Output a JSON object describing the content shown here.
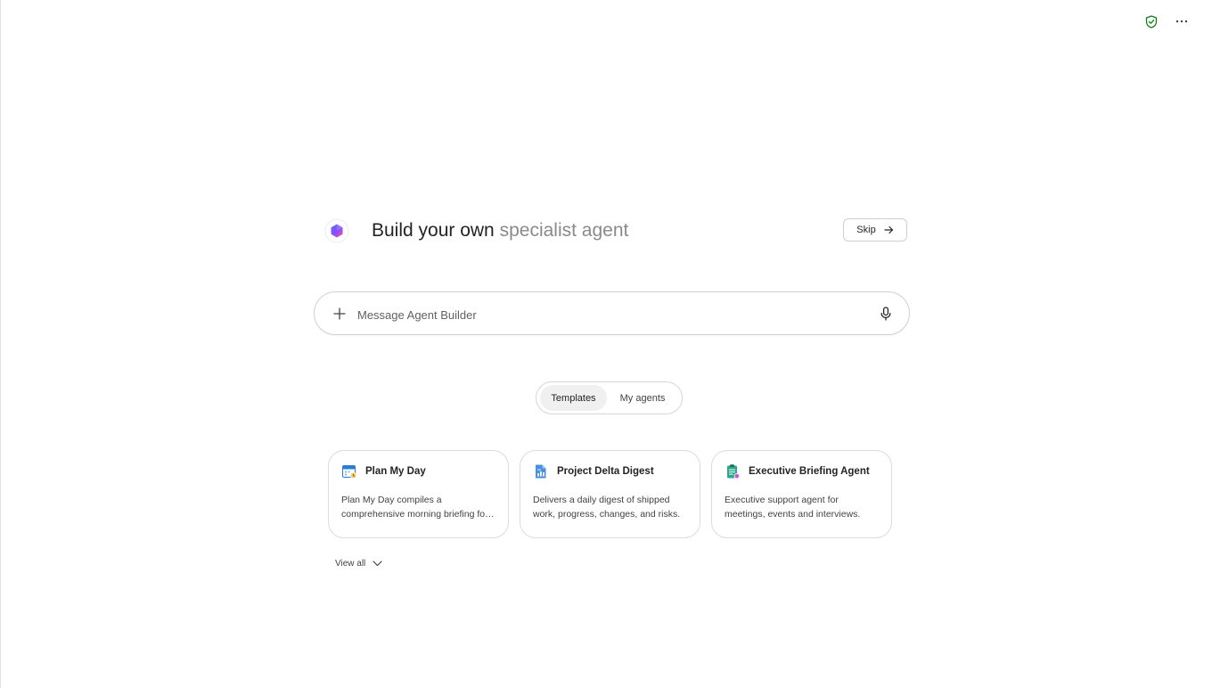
{
  "top_actions": {
    "shield_icon": "shield-check-icon",
    "more_icon": "more-horizontal-icon",
    "shield_color": "#107c10"
  },
  "header": {
    "title_strong": "Build your own",
    "title_soft": "specialist agent",
    "skip_label": "Skip",
    "logo_icon": "copilot-logo-icon"
  },
  "composer": {
    "placeholder": "Message Agent Builder",
    "value": "",
    "add_icon": "plus-icon",
    "mic_icon": "microphone-icon"
  },
  "tabs": [
    {
      "label": "Templates",
      "active": true
    },
    {
      "label": "My agents",
      "active": false
    }
  ],
  "cards": [
    {
      "title": "Plan My Day",
      "description": "Plan My Day compiles a comprehensive morning briefing for you each day.",
      "icon": "calendar-icon"
    },
    {
      "title": "Project Delta Digest",
      "description": "Delivers a daily digest of shipped work, progress, changes, and risks.",
      "icon": "document-chart-icon"
    },
    {
      "title": "Executive Briefing Agent",
      "description": "Executive support agent for meetings, events and interviews.",
      "icon": "clipboard-icon"
    }
  ],
  "view_all": {
    "label": "View all",
    "icon": "chevron-down-icon"
  },
  "colors": {
    "accent_purple": "#7b4dff",
    "accent_pink": "#e0447a",
    "text_primary": "#242424",
    "text_secondary": "#8a8a8a",
    "border": "#d1d1d1"
  }
}
